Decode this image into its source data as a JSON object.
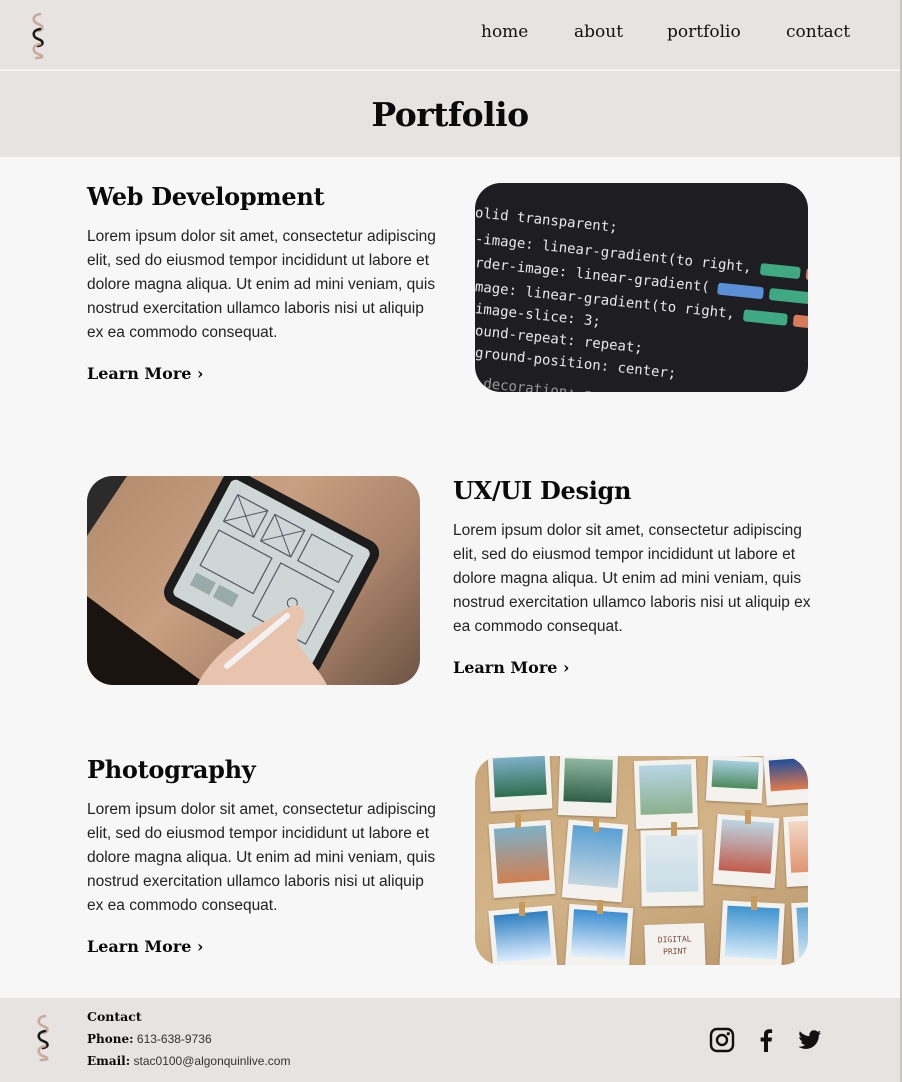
{
  "header": {
    "nav": [
      {
        "label": "home"
      },
      {
        "label": "about"
      },
      {
        "label": "portfolio"
      },
      {
        "label": "contact"
      }
    ]
  },
  "page_title": "Portfolio",
  "sections": [
    {
      "heading": "Web Development",
      "body": "Lorem ipsum dolor sit amet, consectetur adipiscing elit, sed do eiusmod tempor incididunt ut labore et dolore magna aliqua. Ut enim ad mini veniam, quis nostrud exercitation ullamco laboris nisi ut  aliquip ex ea commodo consequat.",
      "link": "Learn More ›"
    },
    {
      "heading": "UX/UI Design",
      "body": "Lorem ipsum dolor sit amet, consectetur adipiscing elit, sed do eiusmod tempor incididunt ut labore et dolore magna aliqua. Ut enim ad mini veniam, quis nostrud exercitation ullamco laboris nisi ut  aliquip ex ea commodo consequat.",
      "link": "Learn More ›"
    },
    {
      "heading": "Photography",
      "body": "Lorem ipsum dolor sit amet, consectetur adipiscing elit, sed do eiusmod tempor incididunt ut labore et dolore magna aliqua. Ut enim ad mini veniam, quis nostrud exercitation ullamco laboris nisi ut  aliquip ex ea commodo consequat.",
      "link": "Learn More ›"
    }
  ],
  "code_image_lines": [
    "olid transparent;",
    "-image: linear-gradient(to right,",
    "rder-image: linear-gradient(",
    "mage: linear-gradient(to right,",
    "image-slice: 3;",
    "ound-repeat: repeat;",
    "ground-position: center;",
    "-decoration: none;"
  ],
  "photo_caption": "DIGITAL PRINT",
  "footer": {
    "contact_heading": "Contact",
    "phone_label": "Phone:",
    "phone": "613-638-9736",
    "email_label": "Email:",
    "email": "stac0100@algonquinlive.com"
  },
  "icons": {
    "logo": "s-wave-logo",
    "social": [
      "instagram-icon",
      "facebook-icon",
      "twitter-icon"
    ]
  },
  "colors": {
    "header_bg": "#e7e3e0",
    "page_bg": "#f7f7f7",
    "logo_tan": "#c8a99a",
    "logo_dark": "#1a1a1a"
  }
}
